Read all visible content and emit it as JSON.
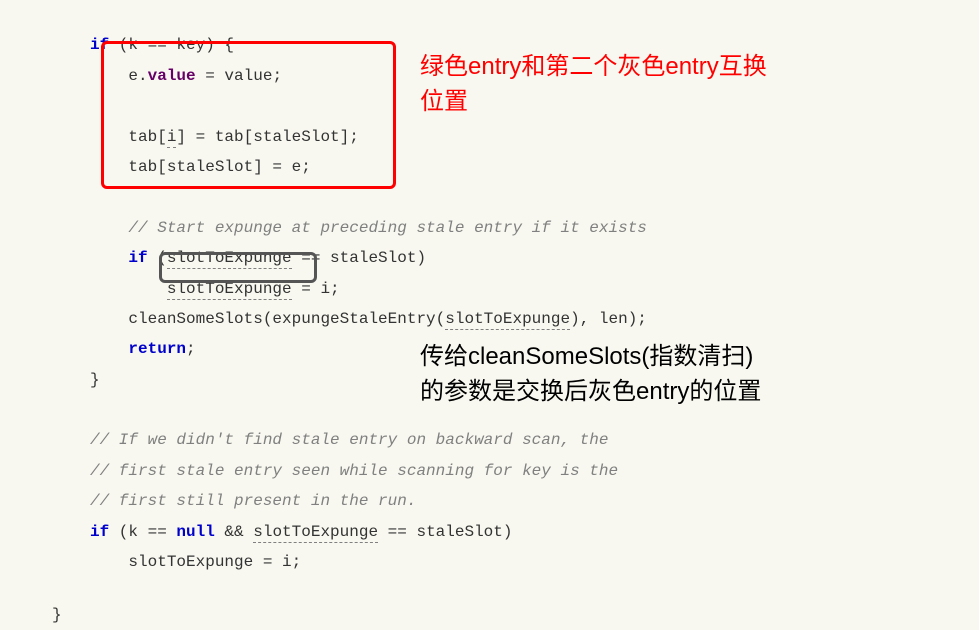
{
  "code": {
    "top_partial": "",
    "l1_kw": "if",
    "l1_rest": " (k == key) {",
    "l2a": "e.",
    "l2b": "value",
    "l2c": " = value;",
    "l4a": "tab[",
    "l4b": "i",
    "l4c": "] = tab[staleSlot];",
    "l5": "tab[staleSlot] = e;",
    "l7_comment": "// Start expunge at preceding stale entry if it exists",
    "l8_kw": "if",
    "l8a": " (",
    "l8b": "slotToExpunge",
    "l8c": " == staleSlot)",
    "l9a": "slotToExpunge",
    "l9b": " = i;",
    "l10a": "cleanSomeSlots(expungeStaleEntry(",
    "l10b": "slotToExpunge",
    "l10c": "), len);",
    "l11_kw": "return",
    "l11b": ";",
    "l12": "}",
    "l14_comment": "// If we didn't find stale entry on backward scan, the",
    "l15_comment": "// first stale entry seen while scanning for key is the",
    "l16_comment": "// first still present in the run.",
    "l17_kw1": "if",
    "l17a": " (k == ",
    "l17_kw2": "null",
    "l17b": " && ",
    "l17c": "slotToExpunge",
    "l17d": " == staleSlot)",
    "l18": "slotToExpunge = i;",
    "l19": "}"
  },
  "annotations": {
    "a1_line1": "绿色entry和第二个灰色entry互换",
    "a1_line2": "位置",
    "a2_line1": "传给cleanSomeSlots(指数清扫)",
    "a2_line2": "的参数是交换后灰色entry的位置"
  }
}
